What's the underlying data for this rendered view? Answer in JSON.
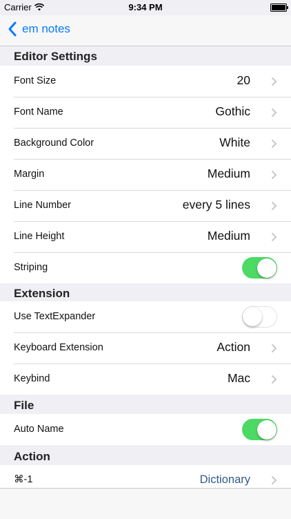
{
  "status_bar": {
    "carrier": "Carrier",
    "time": "9:34 PM"
  },
  "nav": {
    "back_label": "em notes"
  },
  "sections": {
    "editor": {
      "title": "Editor Settings",
      "font_size": {
        "label": "Font Size",
        "value": "20"
      },
      "font_name": {
        "label": "Font Name",
        "value": "Gothic"
      },
      "background_color": {
        "label": "Background Color",
        "value": "White"
      },
      "margin": {
        "label": "Margin",
        "value": "Medium"
      },
      "line_number": {
        "label": "Line Number",
        "value": "every 5 lines"
      },
      "line_height": {
        "label": "Line Height",
        "value": "Medium"
      },
      "striping": {
        "label": "Striping",
        "on": true
      }
    },
    "extension": {
      "title": "Extension",
      "text_expander": {
        "label": "Use TextExpander",
        "on": false
      },
      "keyboard_extension": {
        "label": "Keyboard Extension",
        "value": "Action"
      },
      "keybind": {
        "label": "Keybind",
        "value": "Mac"
      }
    },
    "file": {
      "title": "File",
      "auto_name": {
        "label": "Auto Name",
        "on": true
      }
    },
    "action": {
      "title": "Action",
      "cmd1": {
        "label": "⌘-1",
        "value": "Dictionary"
      }
    }
  },
  "colors": {
    "accent": "#0a7aff",
    "toggle_on": "#4cd964",
    "background": "#efeff4",
    "link_value": "#34588c"
  }
}
